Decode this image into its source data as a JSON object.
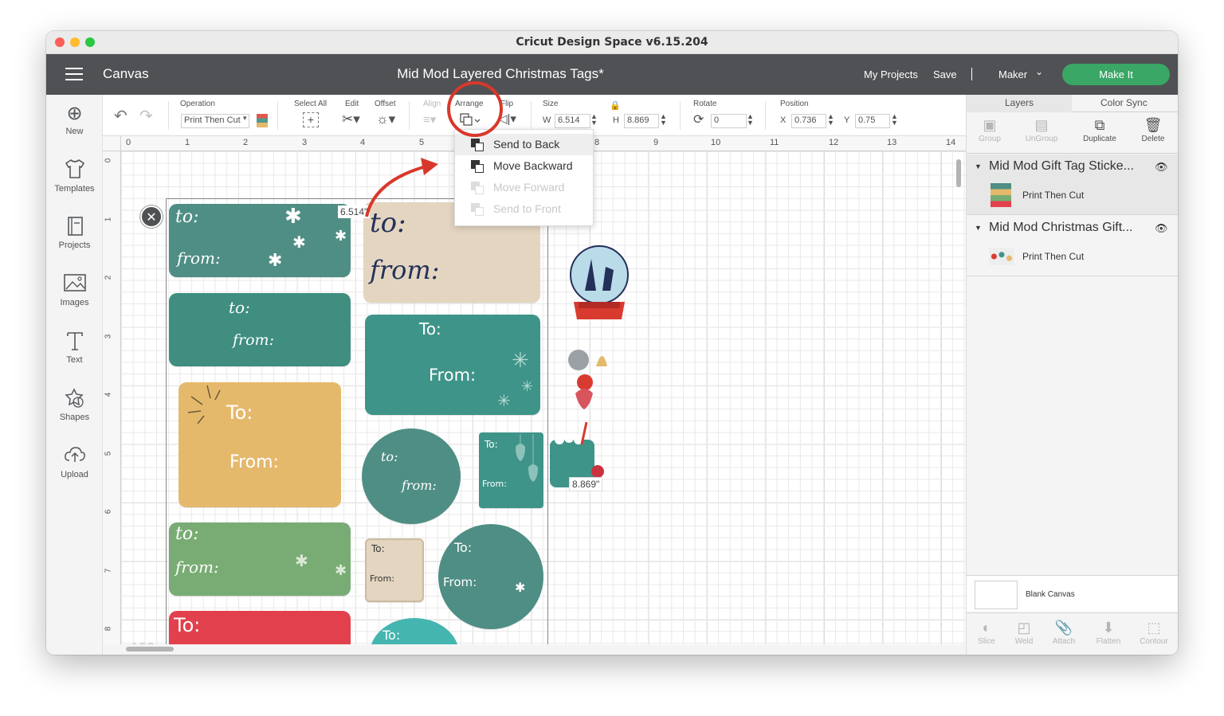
{
  "window": {
    "title": "Cricut Design Space  v6.15.204"
  },
  "header": {
    "section": "Canvas",
    "project_title": "Mid Mod Layered Christmas Tags*",
    "my_projects": "My Projects",
    "save": "Save",
    "machine": "Maker",
    "make_it": "Make It"
  },
  "leftbar": {
    "items": [
      {
        "label": "New",
        "icon": "plus-circle-icon"
      },
      {
        "label": "Templates",
        "icon": "tshirt-icon"
      },
      {
        "label": "Projects",
        "icon": "projects-icon"
      },
      {
        "label": "Images",
        "icon": "image-icon"
      },
      {
        "label": "Text",
        "icon": "text-icon"
      },
      {
        "label": "Shapes",
        "icon": "shapes-icon"
      },
      {
        "label": "Upload",
        "icon": "upload-icon"
      }
    ]
  },
  "toolbar": {
    "operation_label": "Operation",
    "operation_value": "Print Then Cut",
    "select_all": "Select All",
    "edit": "Edit",
    "offset": "Offset",
    "align": "Align",
    "arrange": "Arrange",
    "flip": "Flip",
    "size": "Size",
    "w_label": "W",
    "w_value": "6.514",
    "h_label": "H",
    "h_value": "8.869",
    "rotate": "Rotate",
    "rotate_value": "0",
    "position": "Position",
    "x_label": "X",
    "x_value": "0.736",
    "y_label": "Y",
    "y_value": "0.75"
  },
  "ruler": {
    "top": [
      "0",
      "1",
      "2",
      "3",
      "4",
      "5",
      "6",
      "7",
      "8",
      "9",
      "10",
      "11",
      "12",
      "13",
      "14"
    ],
    "left": [
      "0",
      "1",
      "2",
      "3",
      "4",
      "5",
      "6",
      "7",
      "8"
    ]
  },
  "canvas": {
    "width_readout": "6.514\"",
    "height_readout": "8.869\"",
    "zoom_ghost": "100",
    "tags": {
      "to_script": "to:",
      "from_script": "from:",
      "to_caps": "To:",
      "from_caps": "From:"
    }
  },
  "arrange_menu": {
    "items": [
      {
        "label": "Send to Back",
        "state": "hover"
      },
      {
        "label": "Move Backward",
        "state": "enabled"
      },
      {
        "label": "Move Forward",
        "state": "disabled"
      },
      {
        "label": "Send to Front",
        "state": "disabled"
      }
    ]
  },
  "right_panel": {
    "tabs": [
      "Layers",
      "Color Sync"
    ],
    "actions": [
      "Group",
      "UnGroup",
      "Duplicate",
      "Delete"
    ],
    "layers": [
      {
        "title": "Mid Mod Gift Tag Sticke...",
        "sub": "Print Then Cut"
      },
      {
        "title": "Mid Mod Christmas Gift...",
        "sub": "Print Then Cut"
      }
    ],
    "blank_canvas": "Blank Canvas",
    "bottom_actions": [
      "Slice",
      "Weld",
      "Attach",
      "Flatten",
      "Contour"
    ]
  },
  "colors": {
    "header_bg": "#4f5154",
    "make_it": "#3aa766",
    "teal_dark": "#4f8e84",
    "teal": "#3f9489",
    "beige": "#e3d5c0",
    "mustard": "#e5b96c",
    "green": "#79ac74",
    "red": "#e2404d",
    "annotation_red": "#d8382b"
  }
}
